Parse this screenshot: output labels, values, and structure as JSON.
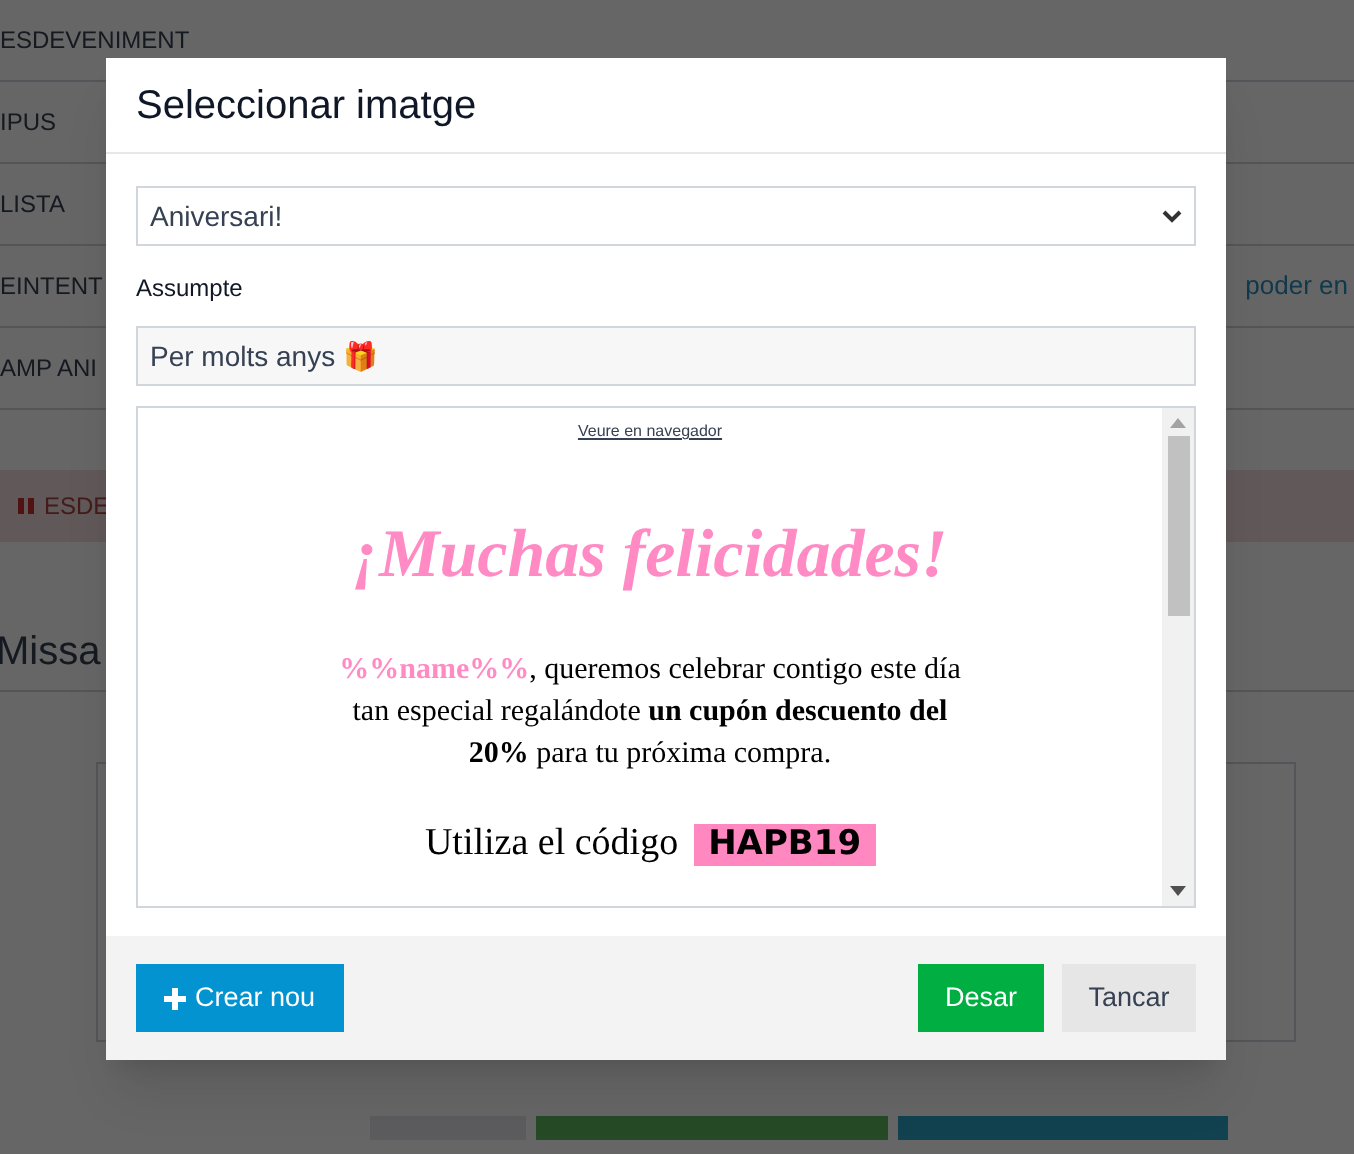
{
  "background_page": {
    "rows": [
      {
        "label": "ESDEVENIMENT"
      },
      {
        "label": "IPUS"
      },
      {
        "label": "LISTA"
      },
      {
        "label": "EINTENT",
        "note": "poder en"
      },
      {
        "label": "AMP ANI"
      }
    ],
    "alert": {
      "text": "ESDE"
    },
    "section_title": "Missa",
    "buttons": [
      {
        "kind": "back"
      },
      {
        "kind": "activate"
      },
      {
        "kind": "stats"
      }
    ]
  },
  "modal": {
    "title": "Seleccionar imatge",
    "template_select": {
      "value": "Aniversari!"
    },
    "subject": {
      "label": "Assumpte",
      "value": "Per molts anys 🎁"
    },
    "preview": {
      "browser_link": "Veure en navegador",
      "heading": "¡Muchas felicidades!",
      "intro_highlight": "%%name%%",
      "intro": ", queremos celebrar contigo este día tan especial regalándote **un cupón descuento del 20%** para tu próxima compra.",
      "code_label": "Utiliza el código",
      "code": "HAPB19"
    },
    "buttons": [
      {
        "label": "Crear nou",
        "kind": "create"
      },
      {
        "label": "Desar",
        "kind": "save"
      },
      {
        "label": "Tancar",
        "kind": "close"
      }
    ]
  }
}
